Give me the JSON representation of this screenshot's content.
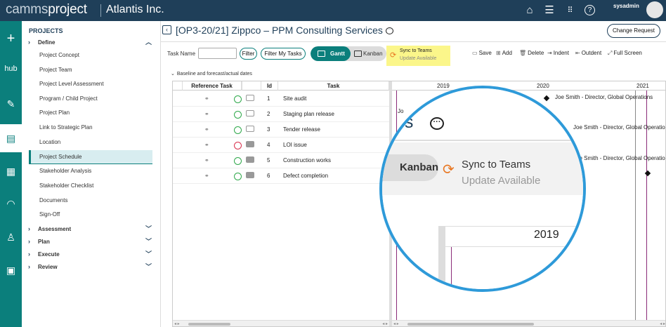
{
  "topbar": {
    "logo_a": "camms",
    "logo_b": "project",
    "org": "Atlantis Inc.",
    "user": "sysadmin",
    "icons": [
      "home-icon",
      "menu-icon",
      "apps-grid-icon",
      "help-icon"
    ]
  },
  "nav": {
    "title": "PROJECTS",
    "define": "Define",
    "items": [
      "Project Concept",
      "Project Team",
      "Project Level Assessment",
      "Program / Child Project",
      "Project Plan",
      "Link to Strategic Plan",
      "Location",
      "Project Schedule",
      "Stakeholder Analysis",
      "Stakeholder Checklist",
      "Documents",
      "Sign-Off"
    ],
    "sections": [
      "Assessment",
      "Plan",
      "Execute",
      "Review"
    ]
  },
  "main": {
    "title": "[OP3-20/21] Zippco – PPM Consulting Services",
    "change_request": "Change Request",
    "task_name_label": "Task Name",
    "filter": "Filter",
    "filter_my": "Filter My Tasks",
    "gantt": "Gantt",
    "kanban": "Kanban",
    "sync_title": "Sync to Teams",
    "sync_sub": "Update Available",
    "toolbar": [
      "Save",
      "Add",
      "Delete",
      "Indent",
      "Outdent",
      "Full Screen"
    ],
    "baseline": "Baseline and forecast/actual dates"
  },
  "grid": {
    "headers": [
      "Reference Task",
      "Id",
      "Task"
    ],
    "rows": [
      {
        "id": "1",
        "task": "Site audit",
        "status": "green",
        "comment": "outline"
      },
      {
        "id": "2",
        "task": "Staging plan release",
        "status": "green",
        "comment": "outline"
      },
      {
        "id": "3",
        "task": "Tender release",
        "status": "green",
        "comment": "outline"
      },
      {
        "id": "4",
        "task": "LOI issue",
        "status": "red",
        "comment": "filled"
      },
      {
        "id": "5",
        "task": "Construction works",
        "status": "green",
        "comment": "filled"
      },
      {
        "id": "6",
        "task": "Defect completion",
        "status": "green",
        "comment": "filled"
      }
    ],
    "years": [
      "2019",
      "2020",
      "2021"
    ],
    "gantt_labels": [
      "Joe Smith - Director, Global Operations",
      "Jo",
      "Joe Smith - Director, Global Operations",
      "Joe Smith - Director, Global Operations"
    ]
  },
  "lens": {
    "title_frag": "es",
    "kanban": "Kanban",
    "sync_title": "Sync to Teams",
    "sync_sub": "Update Available",
    "year": "2019"
  },
  "colors": {
    "brand": "#1f3f59",
    "teal": "#0b7f7c",
    "highlight": "#fbf68a",
    "sync_orange": "#e87722",
    "lens_ring": "#2e9ad9"
  }
}
